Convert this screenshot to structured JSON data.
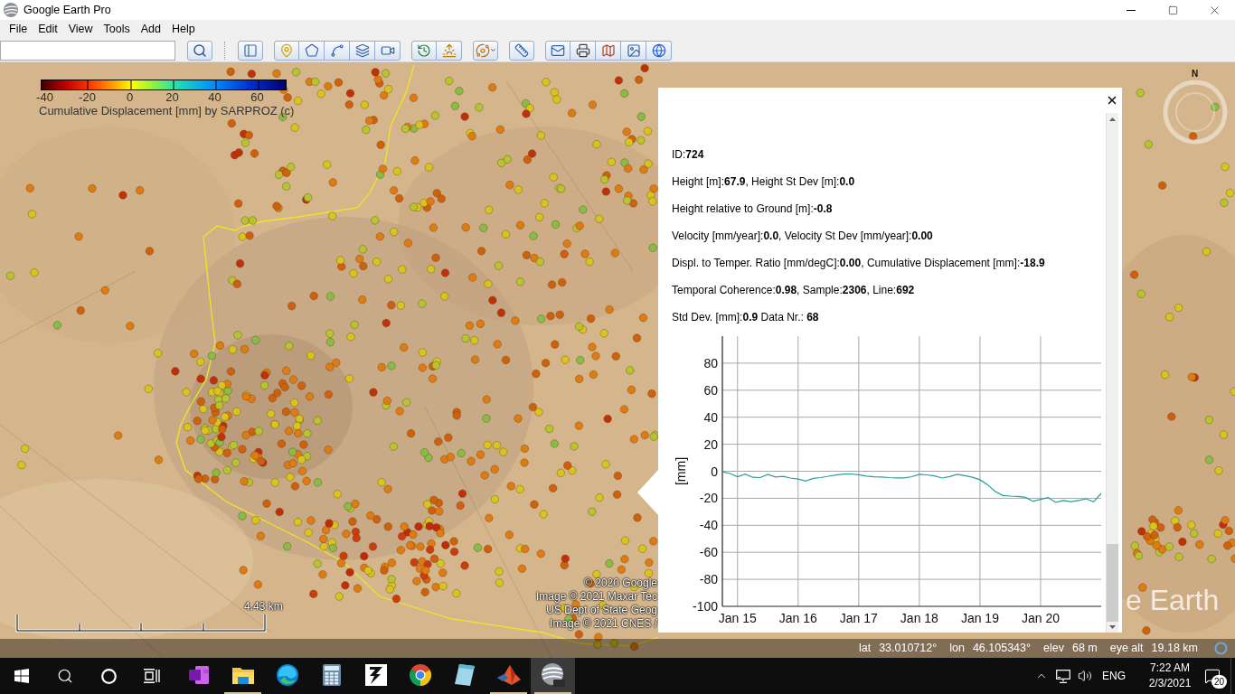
{
  "window": {
    "title": "Google Earth Pro"
  },
  "menu": [
    "File",
    "Edit",
    "View",
    "Tools",
    "Add",
    "Help"
  ],
  "legend": {
    "ticks": [
      "-40",
      "-20",
      "0",
      "20",
      "40",
      "60"
    ],
    "caption": "Cumulative Displacement [mm] by SARPROZ (c)"
  },
  "compass": {
    "north": "N"
  },
  "balloon": {
    "lines": [
      "ID:**724**",
      "Height [m]:**67.9**, Height St Dev [m]:**0.0**",
      "Height relative to Ground [m]:**-0.8**",
      "Velocity [mm/year]:**0.0**, Velocity St Dev [mm/year]:**0.00**",
      "Displ. to Temper. Ratio [mm/degC]:**0.00**, Cumulative Displacement [mm]:**-18.9**",
      "Temporal Coherence:**0.98**, Sample:**2306**, Line:**692**",
      "Std Dev. [mm]:**0.9** Data Nr.: **68**"
    ],
    "chart_data": {
      "type": "line",
      "ylabel": "[mm]",
      "grid": true,
      "categories": [
        null,
        null,
        "Jan 15",
        null,
        null,
        null,
        null,
        null,
        null,
        null,
        "Jan 16",
        null,
        null,
        null,
        null,
        null,
        null,
        null,
        "Jan 17",
        null,
        null,
        null,
        null,
        null,
        null,
        null,
        "Jan 18",
        null,
        null,
        null,
        null,
        null,
        null,
        null,
        "Jan 19",
        null,
        null,
        null,
        null,
        null,
        null,
        null,
        "Jan 20",
        null,
        null,
        null,
        null,
        null,
        null,
        null,
        null
      ],
      "series": [
        {
          "color": "#2a9d9a",
          "values": [
            -0.4,
            -1.7,
            -4,
            -2.1,
            -4.5,
            -4.7,
            -2.3,
            -4.2,
            -3.8,
            -5,
            -5.8,
            -7.3,
            -5.3,
            -4.7,
            -3.7,
            -2.8,
            -2.1,
            -2,
            -2.6,
            -3.6,
            -4.1,
            -4.3,
            -4.7,
            -4.9,
            -4.9,
            -4,
            -2.3,
            -2.7,
            -3.5,
            -5,
            -3.9,
            -2.3,
            -3.3,
            -4.4,
            -6.3,
            -10,
            -14.9,
            -17.9,
            -18.4,
            -18.6,
            -19.3,
            -22.2,
            -20.8,
            -19.5,
            -23,
            -21.7,
            -22.5,
            -21.6,
            -20.4,
            -22.6,
            -16.4
          ]
        }
      ],
      "ylim": [
        -100,
        100
      ],
      "yticks": [
        80,
        60,
        40,
        20,
        0,
        -20,
        -40,
        -60,
        -80,
        -100
      ]
    }
  },
  "attribution": [
    "© 2020 Google",
    "Image © 2021 Maxar Tec",
    "US Dept of State Geog",
    "Image © 2021 CNES /"
  ],
  "logo": "e Earth",
  "scale_bar": {
    "label": "4.43 km"
  },
  "status_bar": [
    {
      "label": "lat",
      "value": "33.010712°"
    },
    {
      "label": "lon",
      "value": "46.105343°"
    },
    {
      "label": "elev",
      "value": "68 m"
    },
    {
      "label": "eye alt",
      "value": "19.18 km"
    }
  ],
  "taskbar": {
    "apps": [
      {
        "running": false,
        "active": false
      },
      {
        "running": true,
        "active": false
      },
      {
        "running": false,
        "active": false
      },
      {
        "running": false,
        "active": false
      },
      {
        "running": false,
        "active": false
      },
      {
        "running": false,
        "active": false
      },
      {
        "running": false,
        "active": false
      },
      {
        "running": true,
        "active": false
      },
      {
        "running": true,
        "active": true
      }
    ],
    "tray": {
      "language": "ENG",
      "time": "7:22 AM",
      "date": "2/3/2021",
      "notifications": "20"
    }
  }
}
